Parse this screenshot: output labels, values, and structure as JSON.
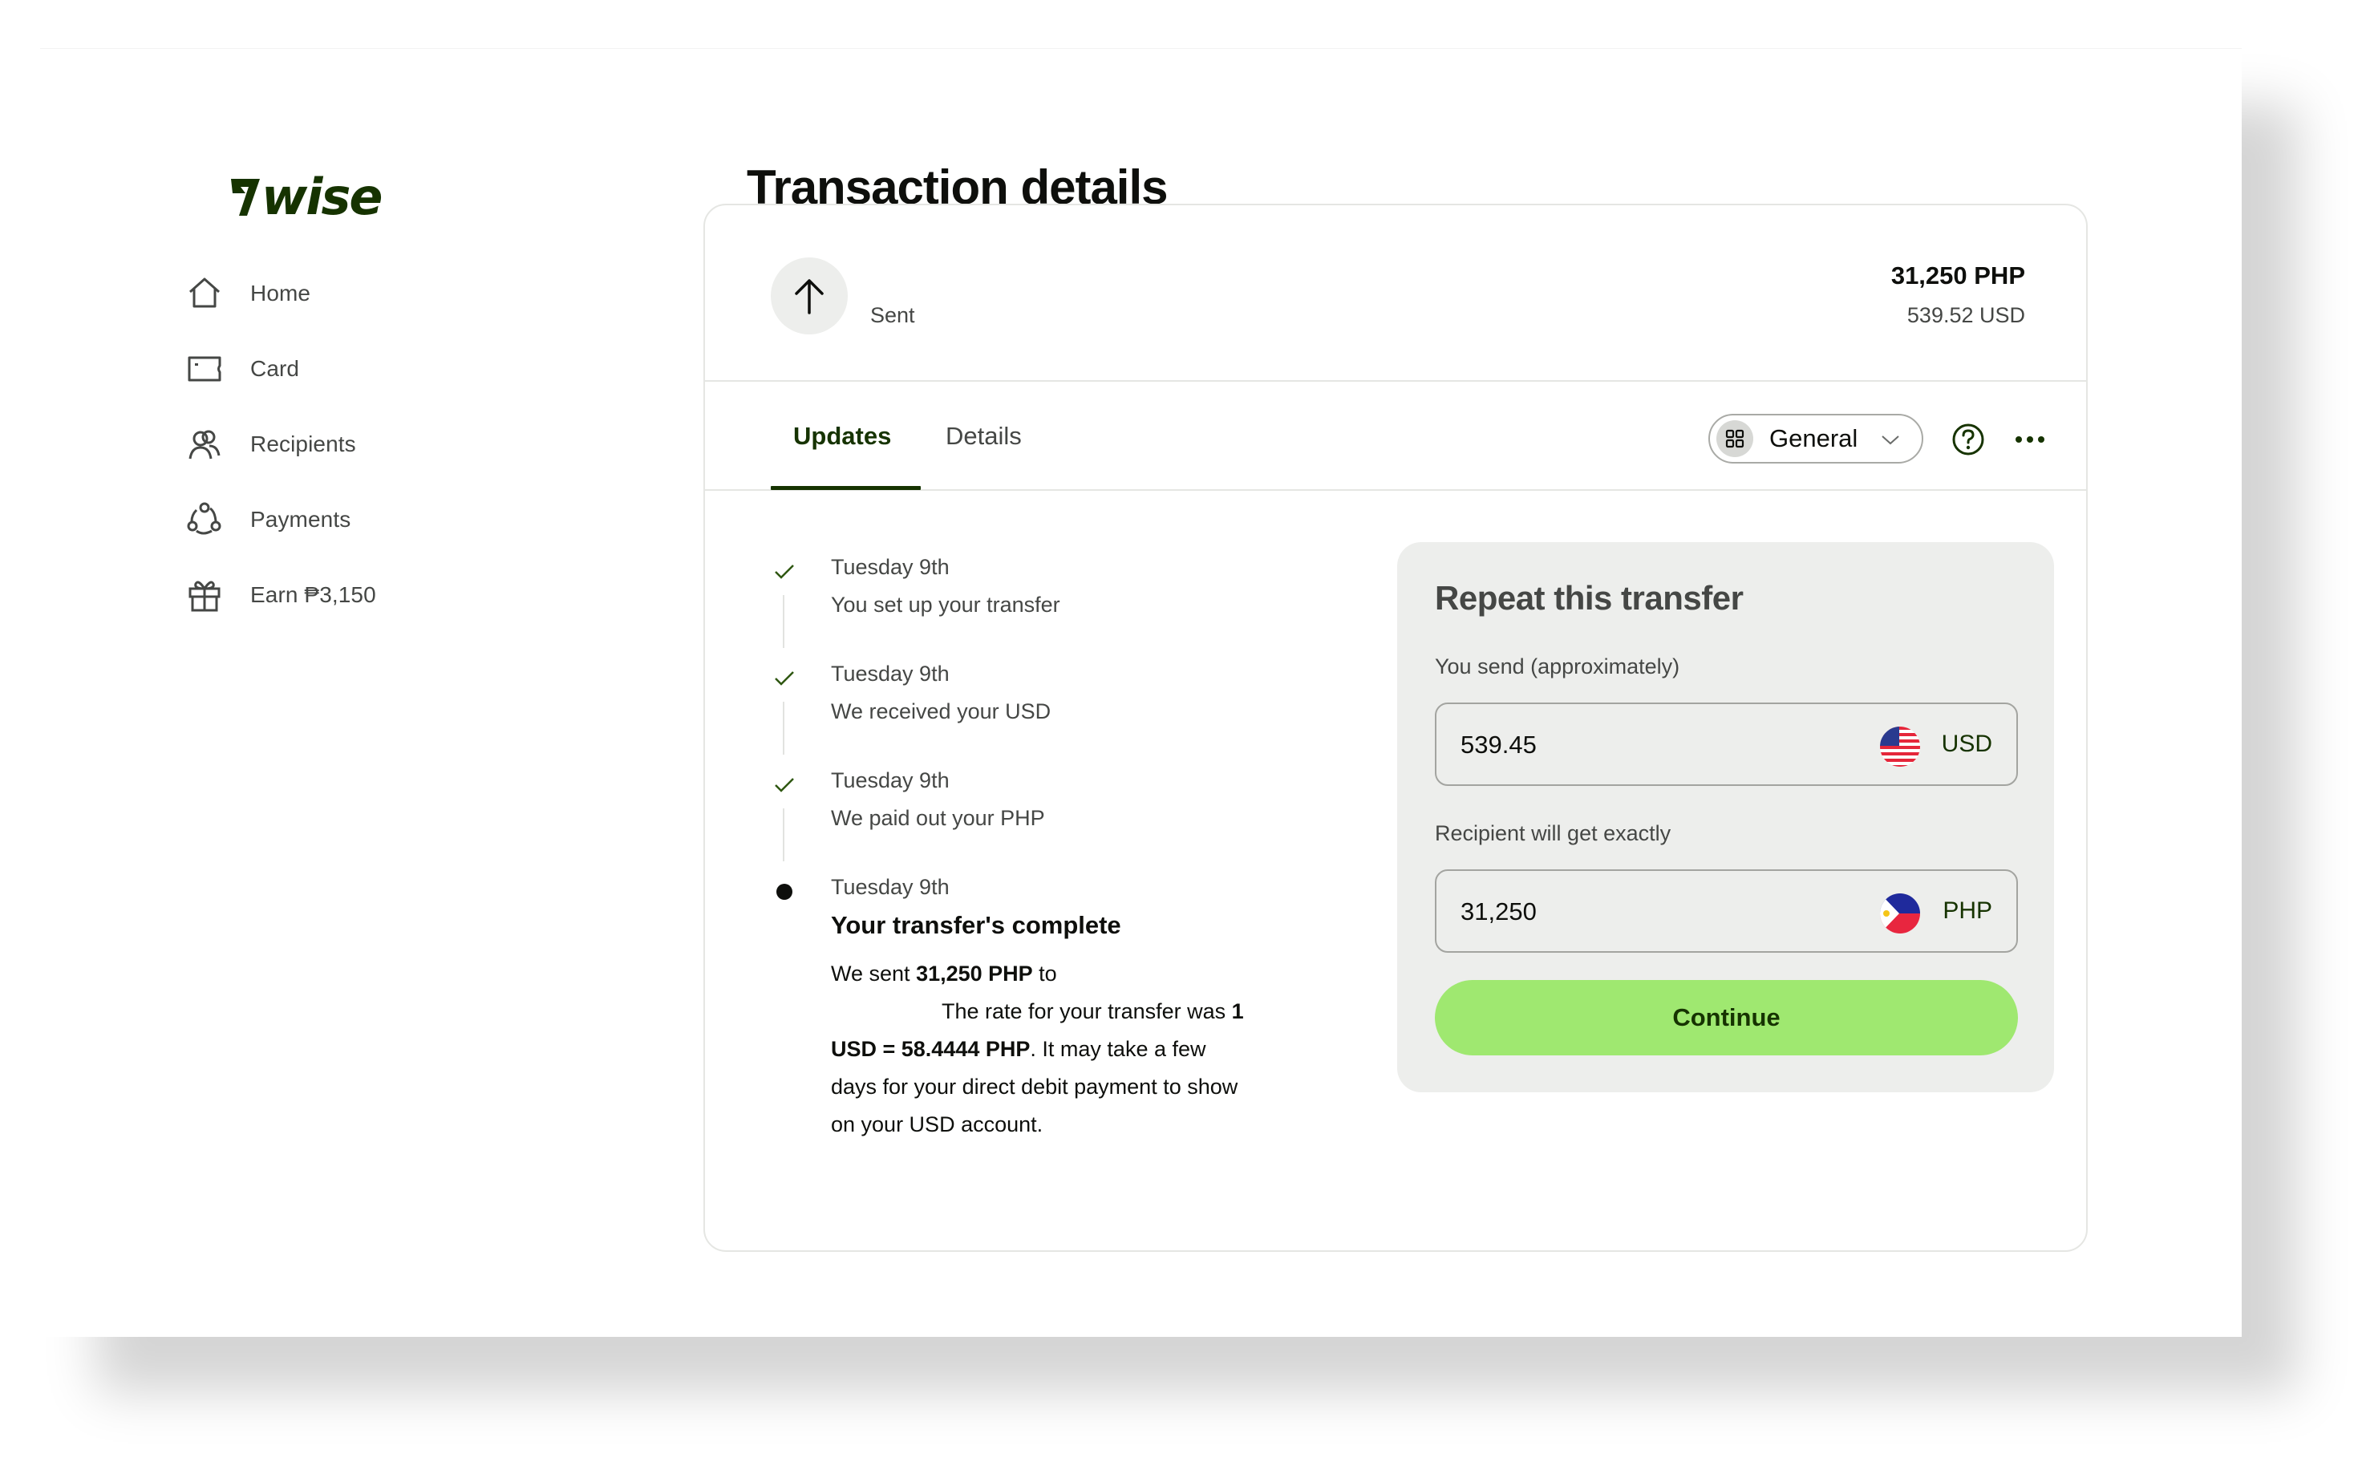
{
  "brand": {
    "name": "wise",
    "color": "#163300",
    "accent": "#9fe870"
  },
  "sidebar": {
    "items": [
      {
        "label": "Home",
        "icon": "home-icon"
      },
      {
        "label": "Card",
        "icon": "card-icon"
      },
      {
        "label": "Recipients",
        "icon": "recipients-icon"
      },
      {
        "label": "Payments",
        "icon": "payments-icon"
      },
      {
        "label": "Earn ₱3,150",
        "icon": "gift-icon"
      }
    ]
  },
  "page": {
    "title": "Transaction details"
  },
  "transaction": {
    "direction_icon": "arrow-up-icon",
    "status_label": "Sent",
    "amount_primary": "31,250 PHP",
    "amount_secondary": "539.52 USD"
  },
  "tabs": [
    {
      "label": "Updates",
      "active": true
    },
    {
      "label": "Details",
      "active": false
    }
  ],
  "toolbar": {
    "category_dropdown": {
      "value": "General",
      "icon": "grid-icon"
    },
    "help_icon": "help-icon",
    "more_icon": "more-icon"
  },
  "timeline": [
    {
      "status": "done",
      "date": "Tuesday 9th",
      "text": "You set up your transfer"
    },
    {
      "status": "done",
      "date": "Tuesday 9th",
      "text": "We received your USD"
    },
    {
      "status": "done",
      "date": "Tuesday 9th",
      "text": "We paid out your PHP"
    },
    {
      "status": "current",
      "date": "Tuesday 9th",
      "title": "Your transfer's complete",
      "body": {
        "prefix": "We sent ",
        "sent_amount": "31,250 PHP",
        "after_amount": " to",
        "rate_intro": "The rate for your transfer was ",
        "rate": "1 USD = 58.4444 PHP",
        "suffix": ". It may take a few days for your direct debit payment to show on your USD account."
      }
    }
  ],
  "repeat_transfer": {
    "title": "Repeat this transfer",
    "send": {
      "label": "You send (approximately)",
      "value": "539.45",
      "currency": "USD",
      "flag": "us-flag-icon"
    },
    "receive": {
      "label": "Recipient will get exactly",
      "value": "31,250",
      "currency": "PHP",
      "flag": "ph-flag-icon"
    },
    "continue_label": "Continue"
  }
}
